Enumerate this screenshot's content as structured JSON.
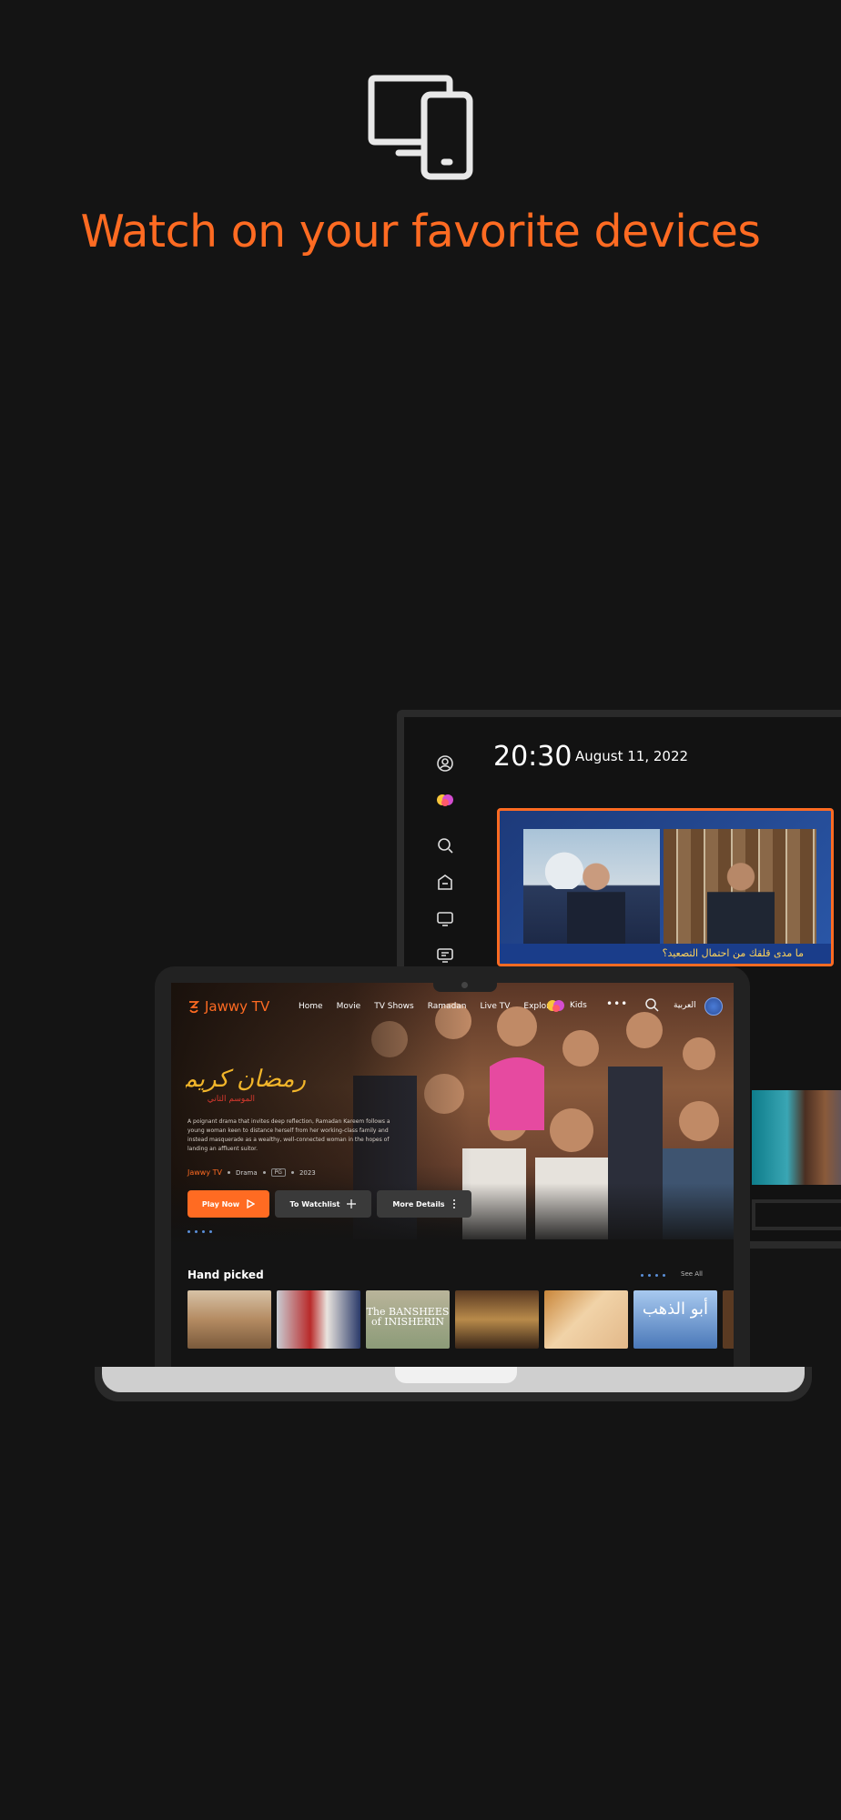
{
  "headline": "Watch on your favorite devices",
  "colors": {
    "accent": "#ff6b22",
    "background": "#141414"
  },
  "tv": {
    "time": "20:30",
    "date": "August 11, 2022",
    "sidebar_icons": [
      "profile-icon",
      "kids-icon",
      "search-icon",
      "home-icon",
      "live-tv-icon",
      "epg-icon"
    ],
    "caption": "ما مدى قلقك من احتمال التصعيد؟"
  },
  "laptop": {
    "brand": "Jawwy TV",
    "nav": [
      "Home",
      "Movie",
      "TV Shows",
      "Ramadan",
      "Live TV",
      "Explore"
    ],
    "kids": "Kids",
    "more": "•••",
    "language": "العربية",
    "hero": {
      "show_title": "رمضان كريم",
      "show_subtitle": "الموسم الثاني",
      "description": "A poignant drama that invites deep reflection, Ramadan Kareem follows a young woman keen to distance herself from her working-class family and instead masquerade as a wealthy, well-connected woman in the hopes of landing an affluent suitor.",
      "meta_brand": "Jawwy TV",
      "genre": "Drama",
      "rating": "PG",
      "year": "2023",
      "play_label": "Play Now",
      "watchlist_label": "To Watchlist",
      "more_label": "More Details"
    },
    "section": {
      "title": "Hand picked",
      "see_all": "See All",
      "posters": [
        "",
        "",
        "The BANSHEES of INISHERIN",
        "",
        "",
        "أبو الذهب",
        ""
      ]
    }
  }
}
